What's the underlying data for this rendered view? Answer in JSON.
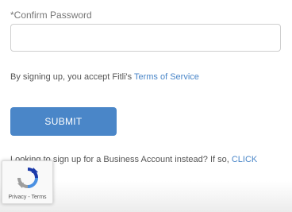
{
  "form": {
    "confirm_password_label": "*Confirm Password",
    "confirm_password_value": "",
    "terms_prefix": "By signing up, you accept Fitli's ",
    "terms_link": "Terms of Service",
    "submit_label": "SUBMIT",
    "business_prefix": "Looking to sign up for a Business Account instead? If so, ",
    "business_link": "CLICK HERE",
    "business_suffix": "."
  },
  "recaptcha": {
    "privacy_label": "Privacy",
    "separator": " - ",
    "terms_label": "Terms"
  },
  "colors": {
    "accent": "#4a86c8",
    "text": "#555555",
    "border": "#cfcfcf"
  },
  "icons": {
    "recaptcha": "recaptcha-logo-icon"
  }
}
